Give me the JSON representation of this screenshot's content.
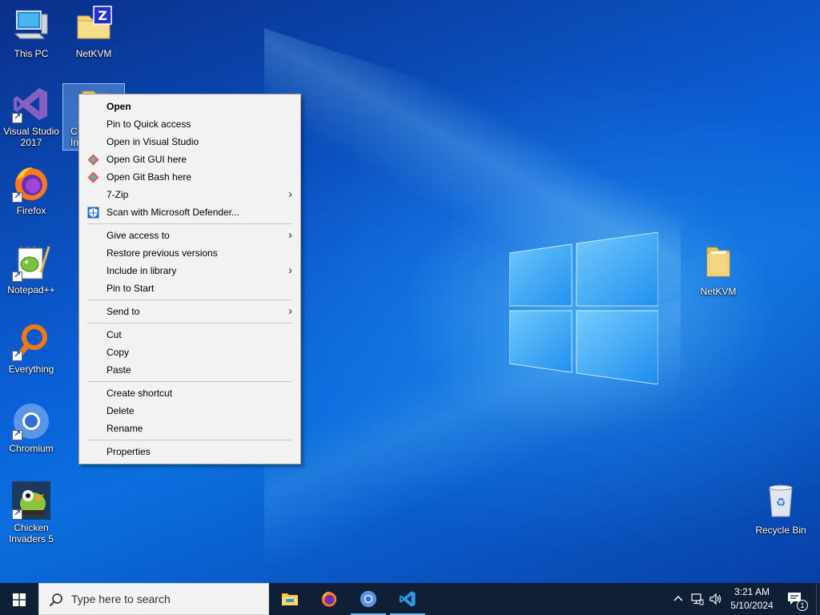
{
  "desktop": {
    "icons": [
      {
        "name": "this-pc-desktop-icon",
        "label": "This PC"
      },
      {
        "name": "netkvm-zip-desktop-icon",
        "label": "NetKVM"
      },
      {
        "name": "visual-studio-desktop-icon",
        "label": "Visual Studio\n2017"
      },
      {
        "name": "selected-desktop-icon",
        "label": "C\nIn"
      },
      {
        "name": "firefox-desktop-icon",
        "label": "Firefox"
      },
      {
        "name": "notepad-plus-plus-desktop-icon",
        "label": "Notepad++"
      },
      {
        "name": "everything-desktop-icon",
        "label": "Everything"
      },
      {
        "name": "chromium-desktop-icon",
        "label": "Chromium"
      },
      {
        "name": "chicken-invaders-desktop-icon",
        "label": "Chicken\nInvaders 5"
      },
      {
        "name": "netkvm-folder-desktop-icon",
        "label": "NetKVM"
      },
      {
        "name": "recycle-bin-desktop-icon",
        "label": "Recycle Bin"
      }
    ]
  },
  "context_menu": {
    "items": [
      {
        "label": "Open"
      },
      {
        "label": "Pin to Quick access"
      },
      {
        "label": "Open in Visual Studio"
      },
      {
        "label": "Open Git GUI here",
        "icon": "git-icon"
      },
      {
        "label": "Open Git Bash here",
        "icon": "git-icon"
      },
      {
        "label": "7-Zip"
      },
      {
        "label": "Scan with Microsoft Defender...",
        "icon": "defender-shield-icon"
      },
      {
        "label": "Give access to"
      },
      {
        "label": "Restore previous versions"
      },
      {
        "label": "Include in library"
      },
      {
        "label": "Pin to Start"
      },
      {
        "label": "Send to"
      },
      {
        "label": "Cut"
      },
      {
        "label": "Copy"
      },
      {
        "label": "Paste"
      },
      {
        "label": "Create shortcut"
      },
      {
        "label": "Delete"
      },
      {
        "label": "Rename"
      },
      {
        "label": "Properties"
      }
    ]
  },
  "taskbar": {
    "search_placeholder": "Type here to search",
    "pinned_apps": [
      "file-explorer-icon",
      "firefox-icon",
      "chromium-icon",
      "vscode-icon"
    ],
    "clock_time": "3:21 AM",
    "clock_date": "5/10/2024",
    "notification_count": "1"
  },
  "colors": {
    "taskbar_bg": "#0f1f36",
    "menu_bg": "#f2f2f2",
    "wallpaper_blue": "#0b5fd6"
  }
}
